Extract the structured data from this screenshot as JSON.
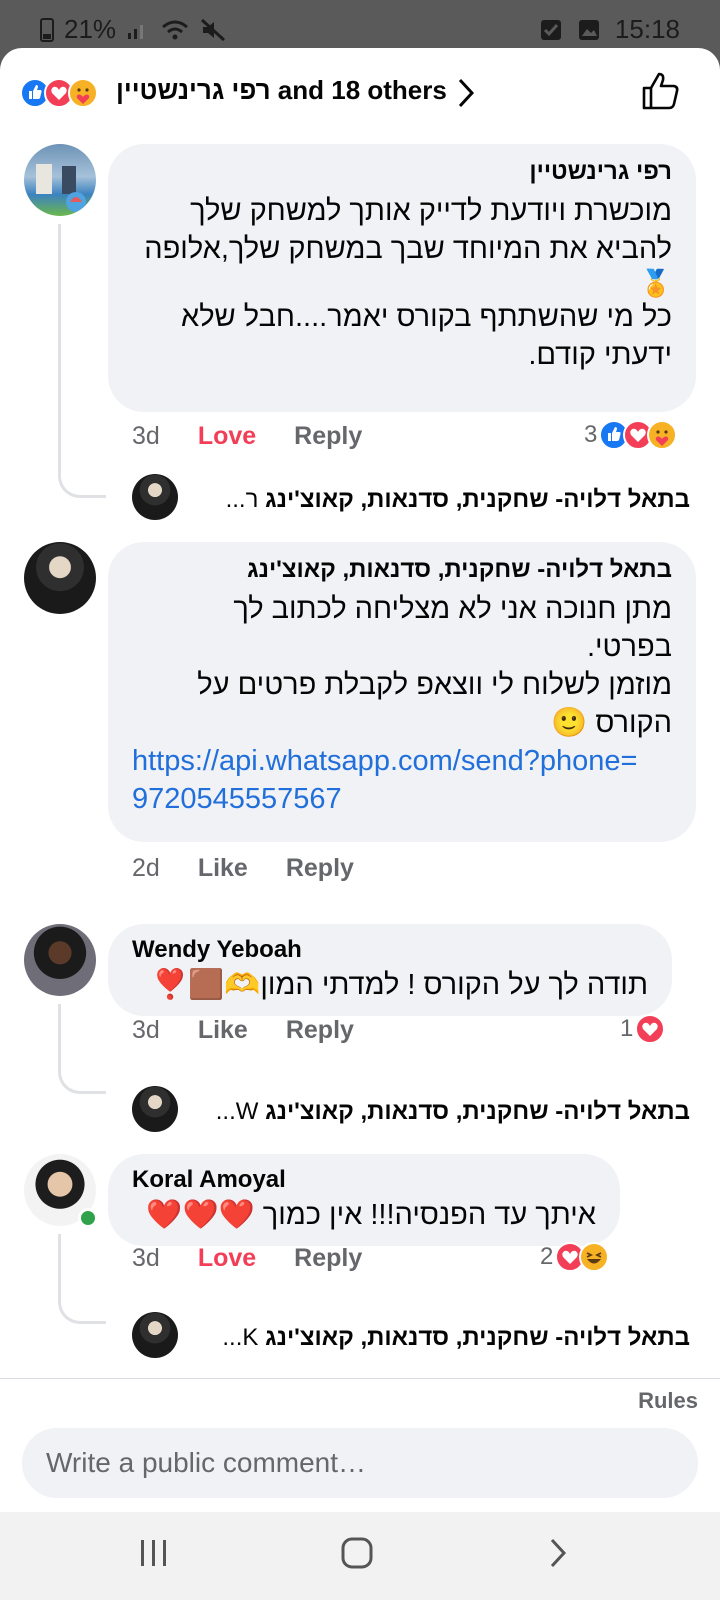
{
  "status_bar": {
    "battery": "21%",
    "time": "15:18"
  },
  "reactions_header": {
    "names": "רפי גרינשטיין",
    "others": "and 18 others",
    "icons": [
      "like",
      "love",
      "care"
    ]
  },
  "comments": [
    {
      "author": "רפי גרינשטיין",
      "lines": [
        "מוכשרת ויודעת לדייק אותך למשחק שלך",
        "להביא את המיוחד שבך במשחק שלך,אלופה",
        "🏅",
        "כל מי שהשתתף בקורס יאמר....חבל שלא",
        "ידעתי קודם."
      ],
      "time": "3d",
      "reaction_action": "Love",
      "reply": "Reply",
      "reaction_count": "3",
      "reaction_icons": [
        "like",
        "love",
        "care"
      ],
      "reply_preview": {
        "prefix": "ר...",
        "author": "בתאל דלויה- שחקנית, סדנאות, קאוצ'ינג"
      }
    },
    {
      "author": "בתאל דלויה- שחקנית, סדנאות, קאוצ'ינג",
      "lines": [
        "מתן חנוכה אני לא מצליחה לכתוב לך",
        "בפרטי.",
        "מוזמן לשלוח לי ווצאפ לקבלת פרטים על",
        "הקורס 🙂"
      ],
      "link": [
        "https://api.whatsapp.com/send?phone=",
        "9720545557567"
      ],
      "time": "2d",
      "reaction_action": "Like",
      "reply": "Reply"
    },
    {
      "author": "Wendy Yeboah",
      "lines": [
        "תודה לך על הקורס ! למדתי המון🫶🟫❣️"
      ],
      "time": "3d",
      "reaction_action": "Like",
      "reply": "Reply",
      "reaction_count": "1",
      "reaction_icons": [
        "love"
      ],
      "reply_preview": {
        "prefix": "W...",
        "author": "בתאל דלויה- שחקנית, סדנאות, קאוצ'ינג"
      }
    },
    {
      "author": "Koral Amoyal",
      "lines": [
        "איתך עד הפנסיה!!! אין כמוך ❤️❤️❤️"
      ],
      "time": "3d",
      "reaction_action": "Love",
      "reply": "Reply",
      "reaction_count": "2",
      "reaction_icons": [
        "love",
        "haha"
      ],
      "reply_preview": {
        "prefix": "K...",
        "author": "בתאל דלויה- שחקנית, סדנאות, קאוצ'ינג"
      }
    }
  ],
  "rules_label": "Rules",
  "composer": {
    "placeholder": "Write a public comment…"
  },
  "colors": {
    "like_blue": "#1877f2",
    "love_red": "#f33e58",
    "link_blue": "#216fdb",
    "bubble": "#f0f2f5"
  }
}
